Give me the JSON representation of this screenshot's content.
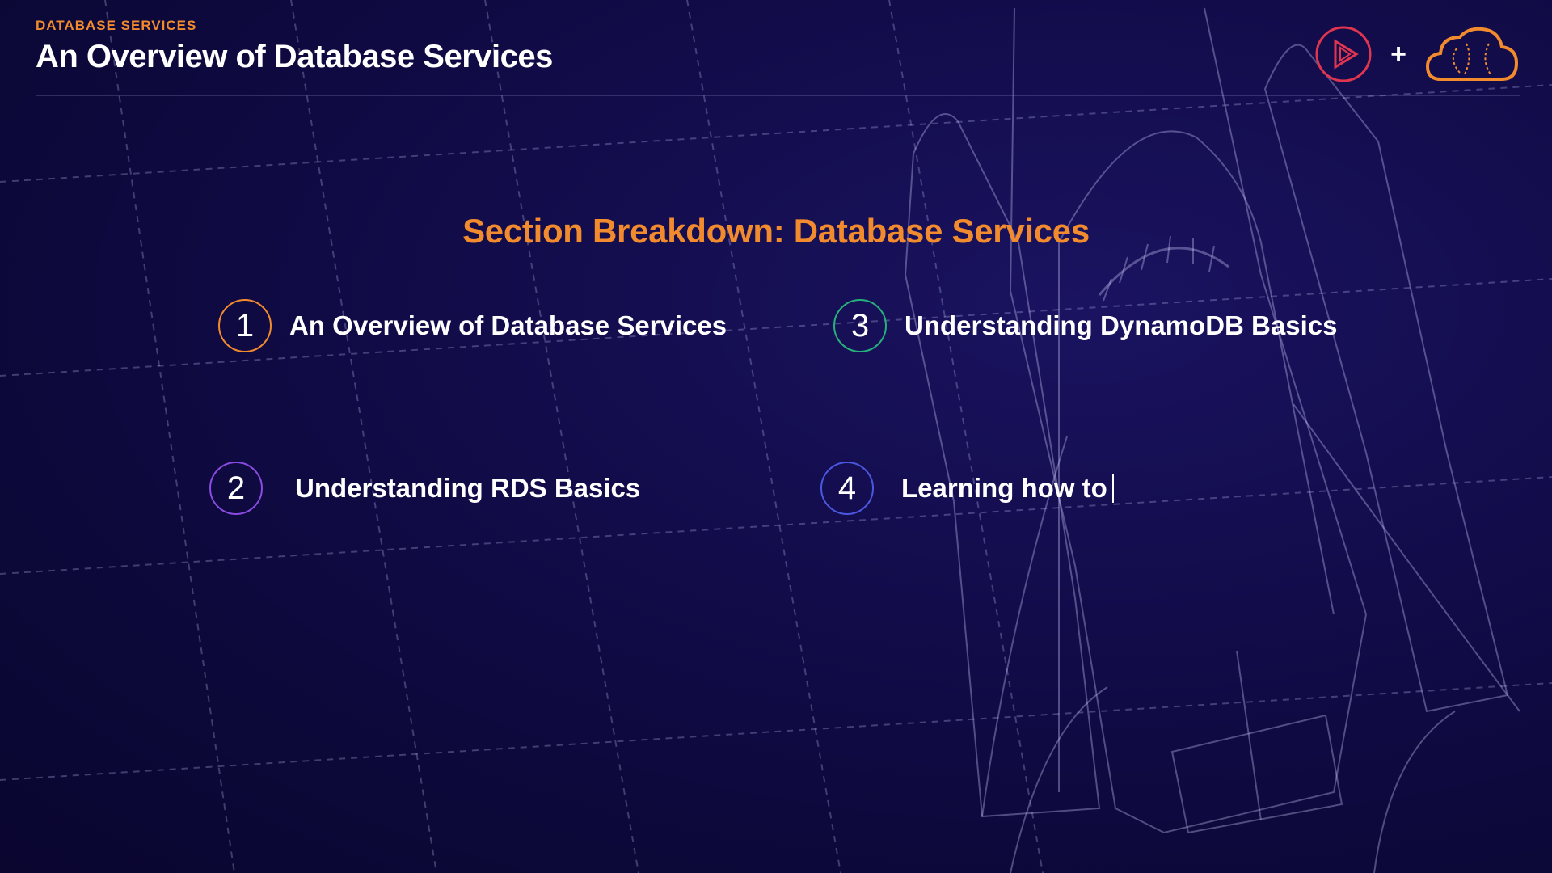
{
  "header": {
    "eyebrow": "DATABASE SERVICES",
    "title": "An Overview of Database Services"
  },
  "brand": {
    "play_icon": "pluralsight-play-icon",
    "plus": "+",
    "cloud_icon": "cloud-logo-icon",
    "colors": {
      "play": "#e0354f",
      "cloud": "#f28a2e"
    }
  },
  "section_title": "Section Breakdown: Database Services",
  "items": [
    {
      "number": "1",
      "label": "An Overview of Database Services",
      "color": "#f28a2e"
    },
    {
      "number": "2",
      "label": "Understanding RDS Basics",
      "color": "#8a4be0"
    },
    {
      "number": "3",
      "label": "Understanding DynamoDB Basics",
      "color": "#26b07a"
    },
    {
      "number": "4",
      "label": "Learning how to",
      "color": "#4a58e0"
    }
  ],
  "colors": {
    "accent": "#f28a2e",
    "background": "#120c4a"
  }
}
